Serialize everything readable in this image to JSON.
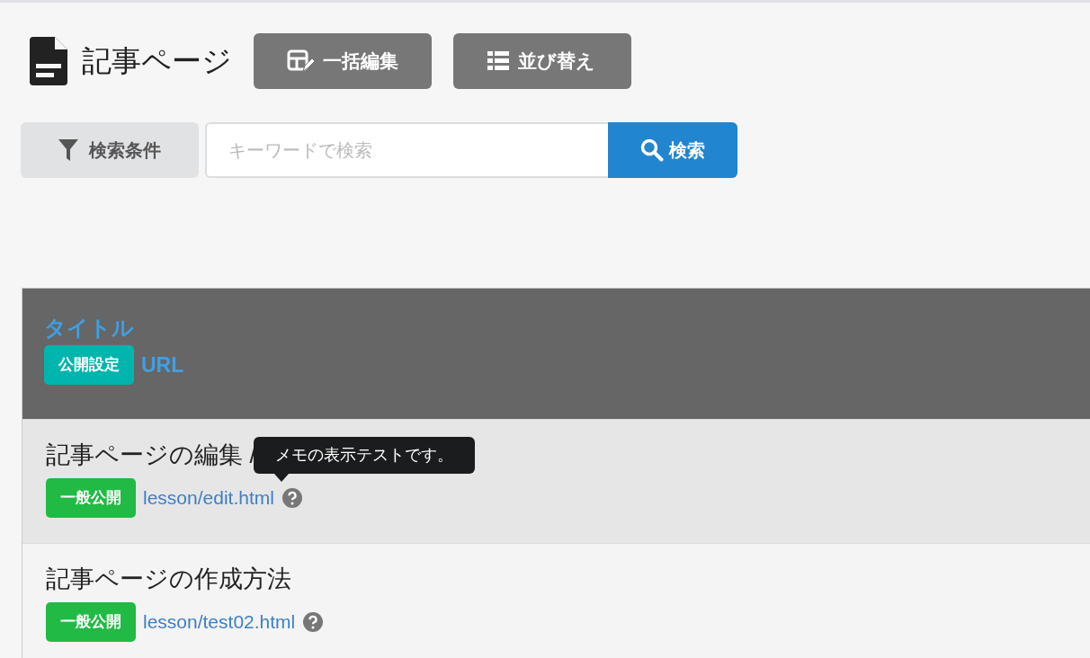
{
  "page": {
    "title": "記事ページ"
  },
  "toolbar_buttons": [
    {
      "label": "一括編集",
      "kind": "bulk-edit"
    },
    {
      "label": "並び替え",
      "kind": "sort"
    }
  ],
  "search": {
    "filter_label": "検索条件",
    "placeholder": "キーワードで検索",
    "button": "検索"
  },
  "table": {
    "header": {
      "title": "タイトル",
      "badge": "公開設定",
      "url": "URL"
    },
    "rows": [
      {
        "title": "記事ページの編集 /",
        "status": "一般公開",
        "url": "lesson/edit.html",
        "hovered": true,
        "memo_tooltip": "メモの表示テストです。"
      },
      {
        "title": "記事ページの作成方法",
        "status": "一般公開",
        "url": "lesson/test02.html",
        "hovered": false
      }
    ]
  }
}
